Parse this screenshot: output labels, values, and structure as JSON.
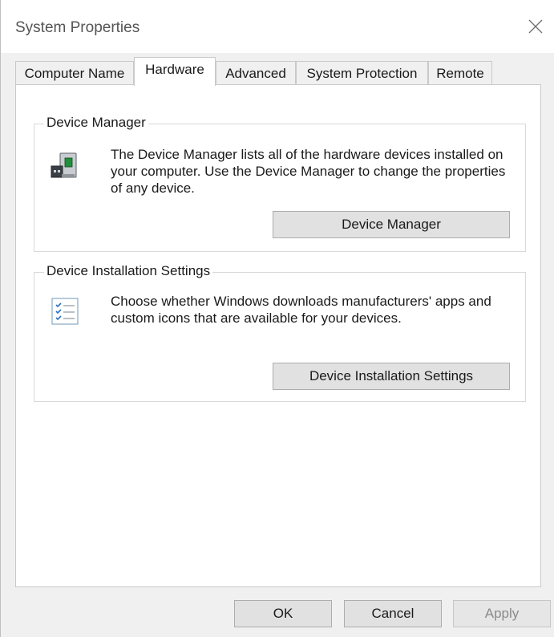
{
  "window": {
    "title": "System Properties"
  },
  "tabs": [
    {
      "label": "Computer Name",
      "active": false
    },
    {
      "label": "Hardware",
      "active": true
    },
    {
      "label": "Advanced",
      "active": false
    },
    {
      "label": "System Protection",
      "active": false
    },
    {
      "label": "Remote",
      "active": false
    }
  ],
  "device_manager": {
    "group_title": "Device Manager",
    "description": "The Device Manager lists all of the hardware devices installed on your computer. Use the Device Manager to change the properties of any device.",
    "button_label": "Device Manager",
    "icon": "device-manager-icon"
  },
  "device_installation": {
    "group_title": "Device Installation Settings",
    "description": "Choose whether Windows downloads manufacturers' apps and custom icons that are available for your devices.",
    "button_label": "Device Installation Settings",
    "icon": "checklist-icon"
  },
  "footer": {
    "ok_label": "OK",
    "cancel_label": "Cancel",
    "apply_label": "Apply"
  },
  "icons": {
    "close": "close-icon"
  }
}
